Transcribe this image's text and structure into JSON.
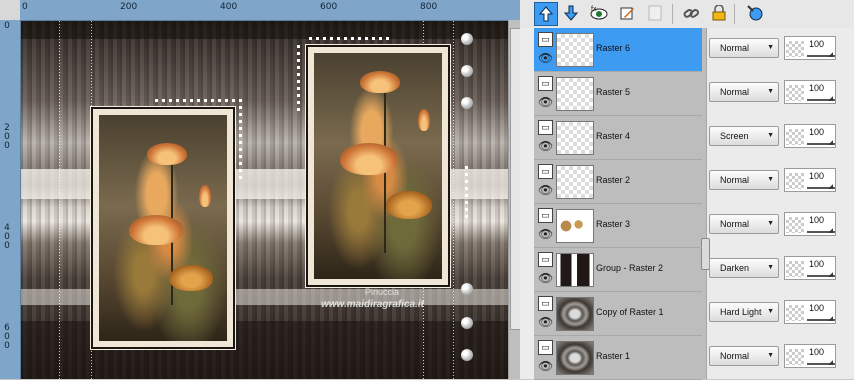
{
  "ruler": {
    "h_labels": [
      "0",
      "200",
      "400",
      "600",
      "800"
    ],
    "v_labels": [
      "0",
      "2",
      "0",
      "0",
      "4",
      "0",
      "0",
      "6",
      "0",
      "0"
    ]
  },
  "canvas": {
    "watermark": "www.maidiragrafica.it",
    "watermark_logo": "Pinuccia"
  },
  "toolbar": {
    "buttons": [
      "move-layer-up-icon",
      "move-layer-down-icon",
      "toggle-visibility-icon",
      "edit-layer-icon",
      "mask-icon",
      "link-icon",
      "lock-icon",
      "properties-icon"
    ]
  },
  "layers": [
    {
      "name": "Raster 6",
      "selected": true,
      "thumb": "transparent",
      "blend": "Normal",
      "opacity": "100"
    },
    {
      "name": "Raster 5",
      "selected": false,
      "thumb": "transparent",
      "blend": "Normal",
      "opacity": "100"
    },
    {
      "name": "Raster 4",
      "selected": false,
      "thumb": "transparent",
      "blend": "Screen",
      "opacity": "100"
    },
    {
      "name": "Raster 2",
      "selected": false,
      "thumb": "transparent",
      "blend": "Normal",
      "opacity": "100"
    },
    {
      "name": "Raster 3",
      "selected": false,
      "thumb": "ornament",
      "blend": "Normal",
      "opacity": "100"
    },
    {
      "name": "Group - Raster 2",
      "selected": false,
      "thumb": "dark",
      "blend": "Darken",
      "opacity": "100"
    },
    {
      "name": "Copy of Raster 1",
      "selected": false,
      "thumb": "metal",
      "blend": "Hard Light",
      "opacity": "100"
    },
    {
      "name": "Raster 1",
      "selected": false,
      "thumb": "metal",
      "blend": "Normal",
      "opacity": "100"
    }
  ],
  "colors": {
    "selection": "#3d9bf2",
    "ruler": "#7fa6c8",
    "panel": "#bdbdbd"
  }
}
